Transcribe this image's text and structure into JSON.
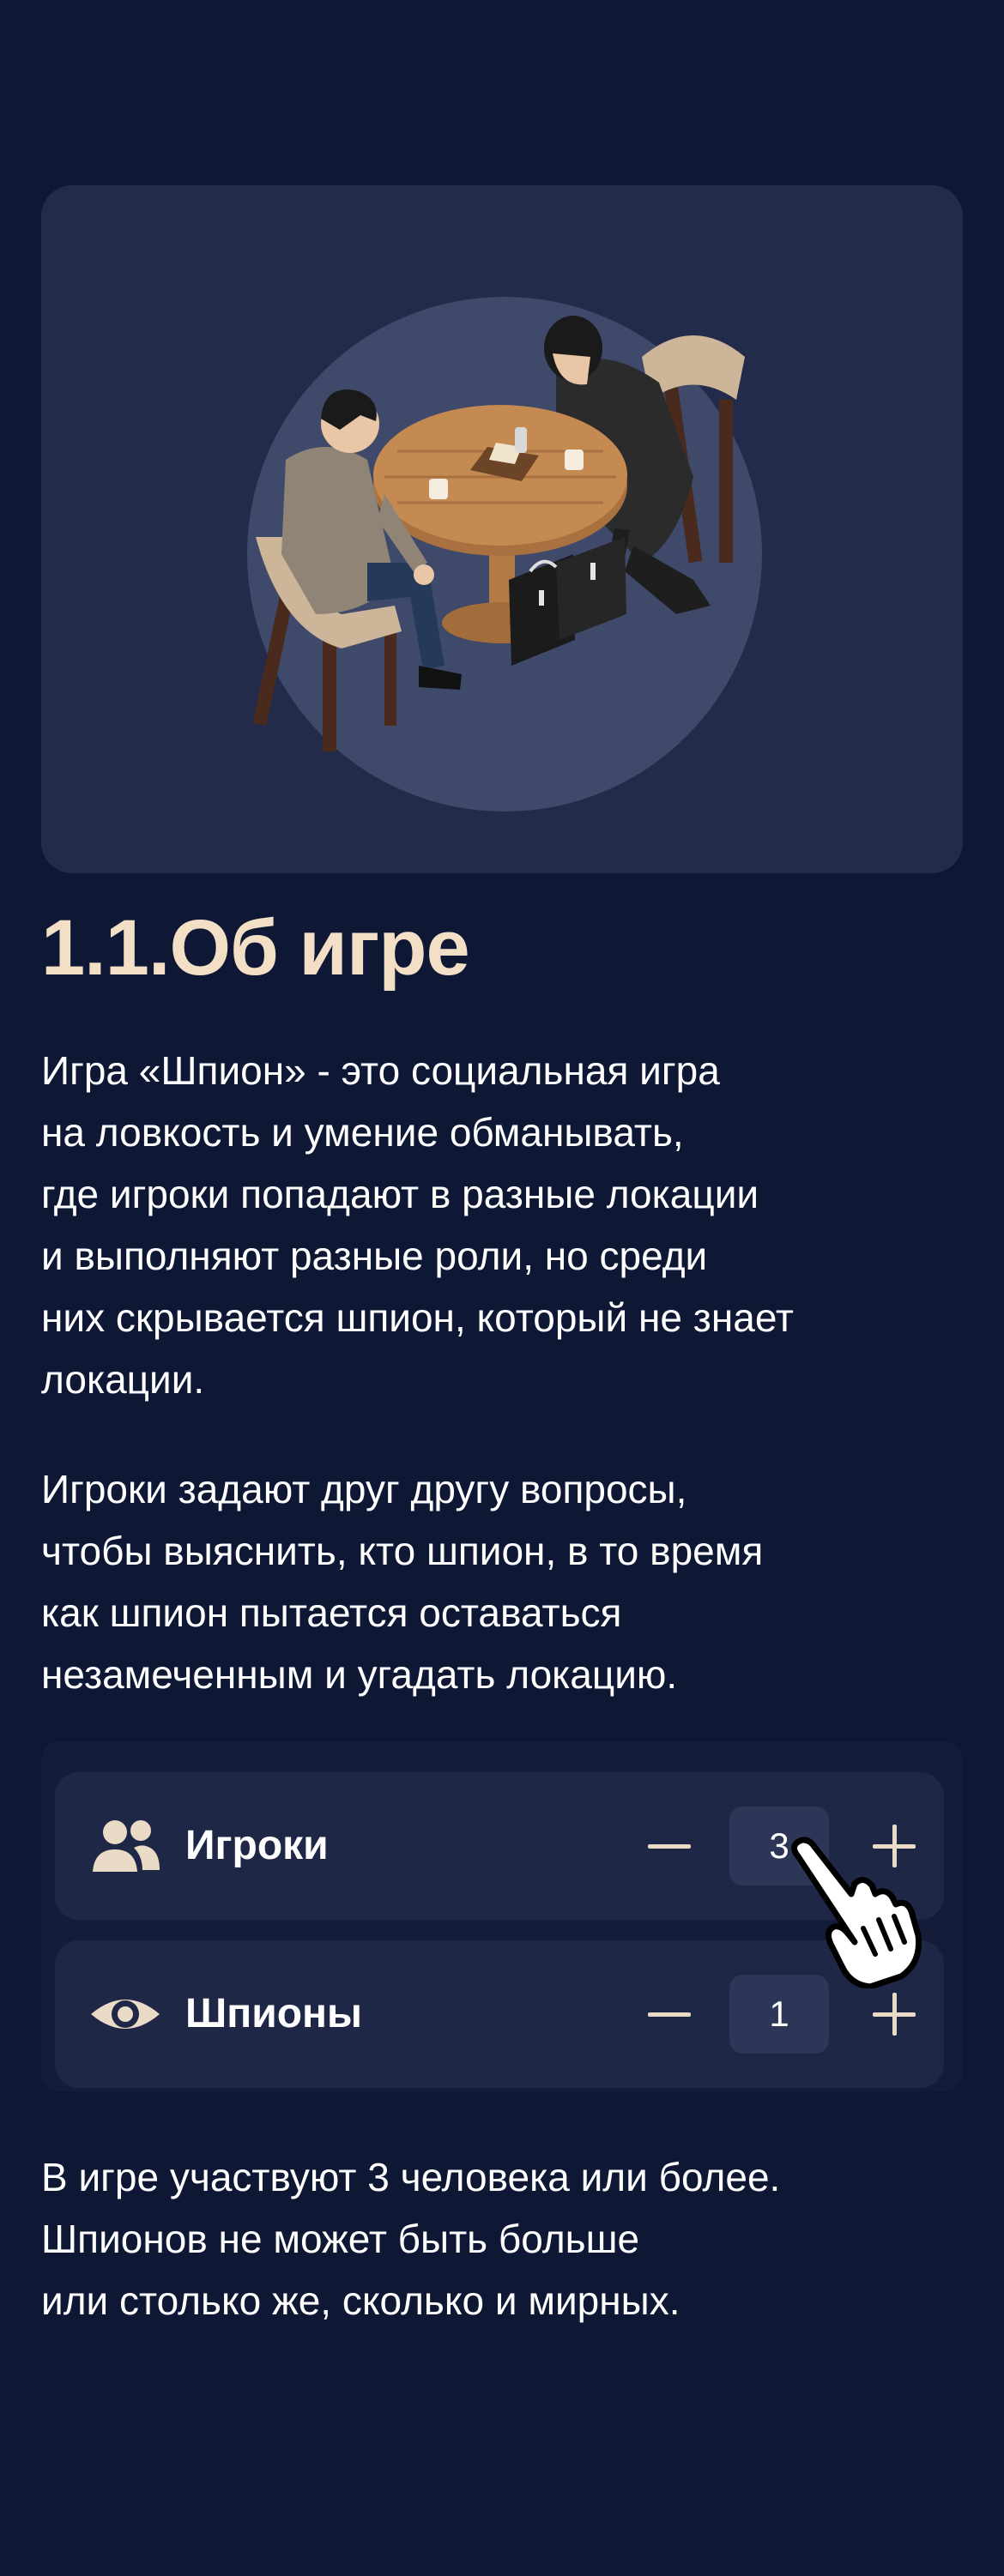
{
  "section": {
    "title": "1.1.Об игре"
  },
  "intro": {
    "paragraph_1": "Игра «Шпион» - это социальная игра\nна ловкость и умение обманывать,\nгде игроки попадают в разные локации\nи выполняют разные роли, но среди\nних скрывается шпион, который не знает\nлокации.",
    "paragraph_2": "Игроки задают друг другу вопросы,\nчтобы выяснить, кто шпион, в то время\nкак шпион пытается оставаться\nнезамеченным и угадать локацию."
  },
  "settings": {
    "players": {
      "label": "Игроки",
      "value": "3",
      "icon": "people-icon"
    },
    "spies": {
      "label": "Шпионы",
      "value": "1",
      "icon": "eye-icon"
    }
  },
  "footer_note": "В игре участвуют 3 человека или более.\nШпионов не может быть больше\nили столько же, сколько и мирных.",
  "colors": {
    "background": "#0e1734",
    "card": "#222c4a",
    "accent_cream": "#f3dfc6",
    "control_row": "#1f2746"
  }
}
